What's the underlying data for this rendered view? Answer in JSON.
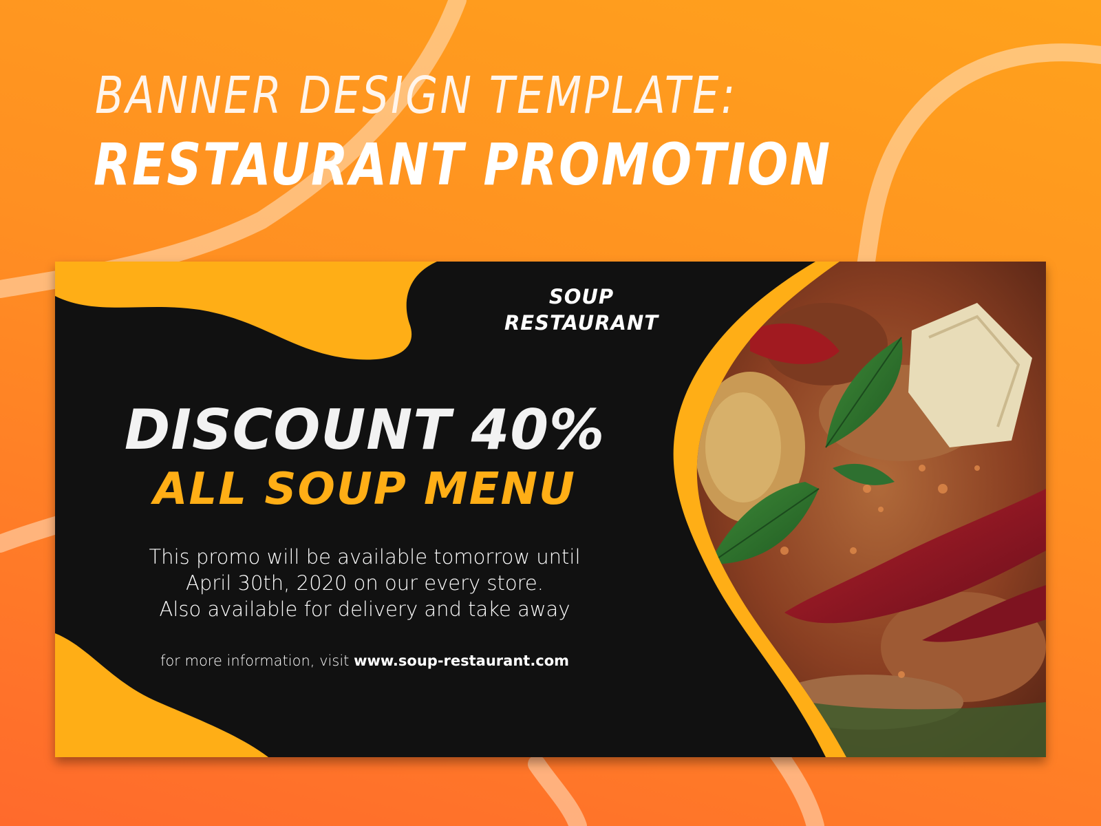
{
  "headline": {
    "line1": "BANNER DESIGN TEMPLATE:",
    "line2": "RESTAURANT PROMOTION"
  },
  "banner": {
    "brand_line1": "SOUP",
    "brand_line2": "RESTAURANT",
    "discount": "DISCOUNT 40%",
    "menu": "ALL SOUP MENU",
    "description": [
      "This promo will be available tomorrow until",
      "April 30th, 2020 on our every store.",
      "Also available for delivery and take away"
    ],
    "more_info_prefix": "for more information, visit",
    "website": "www.soup-restaurant.com",
    "photo_subject": "red curry soup with basil and chili"
  },
  "colors": {
    "background_top": "#ffa21c",
    "background_bottom": "#ff6a2c",
    "banner_dark": "#111111",
    "accent_yellow": "#ffae16",
    "text_white": "#ffffff"
  }
}
